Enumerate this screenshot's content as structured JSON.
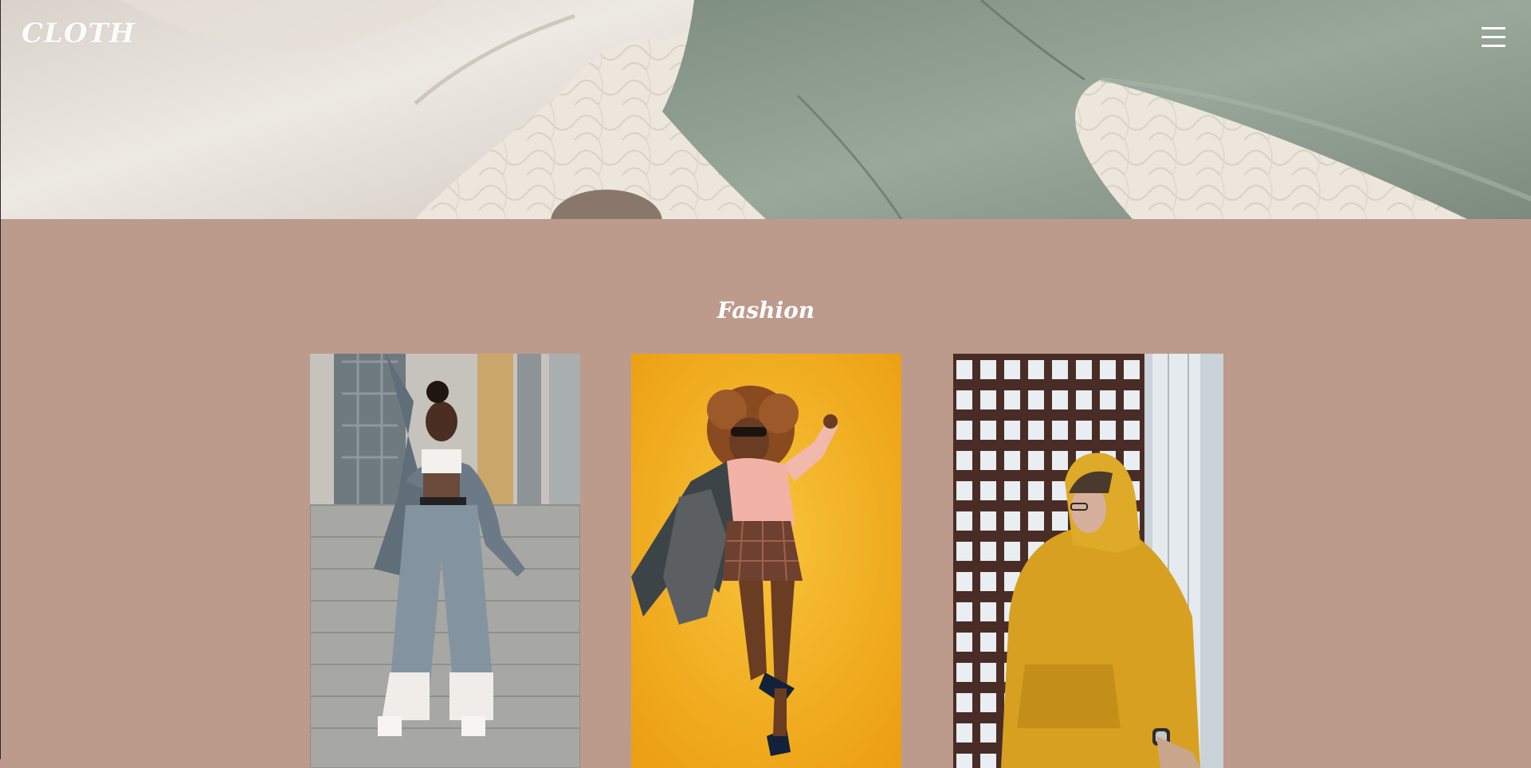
{
  "brand": {
    "name": "CLOTH"
  },
  "header": {
    "menu_icon": "hamburger-menu-icon"
  },
  "fashion": {
    "title": "Fashion",
    "items": [
      {
        "image": "woman-gray-suit-stairs-photo"
      },
      {
        "image": "woman-yellow-background-jump-photo"
      },
      {
        "image": "man-yellow-hoodie-building-photo"
      }
    ]
  },
  "colors": {
    "section_bg": "#bc9b8d",
    "hero_fabric_light": "#e9e3da",
    "hero_fabric_green": "#8b9a8d",
    "card_yellow": "#f2b21d",
    "hoodie_yellow": "#d8a020"
  }
}
